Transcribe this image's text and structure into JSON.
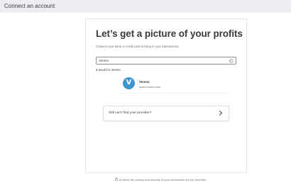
{
  "window": {
    "title": "Connect an account"
  },
  "main": {
    "heading": "Let’s get a picture of your profits",
    "subtext": "Connect your bank or credit card to bring in your transactions."
  },
  "search": {
    "value": "Venmo"
  },
  "results": {
    "count": "1",
    "count_suffix": " result for Venmo"
  },
  "provider": {
    "logo_letter": "V",
    "name": "Venmo",
    "url": "www.venmo.com"
  },
  "find_provider": {
    "label": "Still can’t find your provider?"
  },
  "footer": {
    "note": "At Intuit, the privacy and security of your information are top priorities."
  },
  "colors": {
    "titlebar": "#eceef1",
    "text": "#393a3d",
    "muted": "#6b6c72",
    "venmo_blue": "#3d95ce"
  },
  "icons": [
    "clear-icon",
    "chevron-right-icon",
    "lock-icon",
    "venmo-logo"
  ]
}
